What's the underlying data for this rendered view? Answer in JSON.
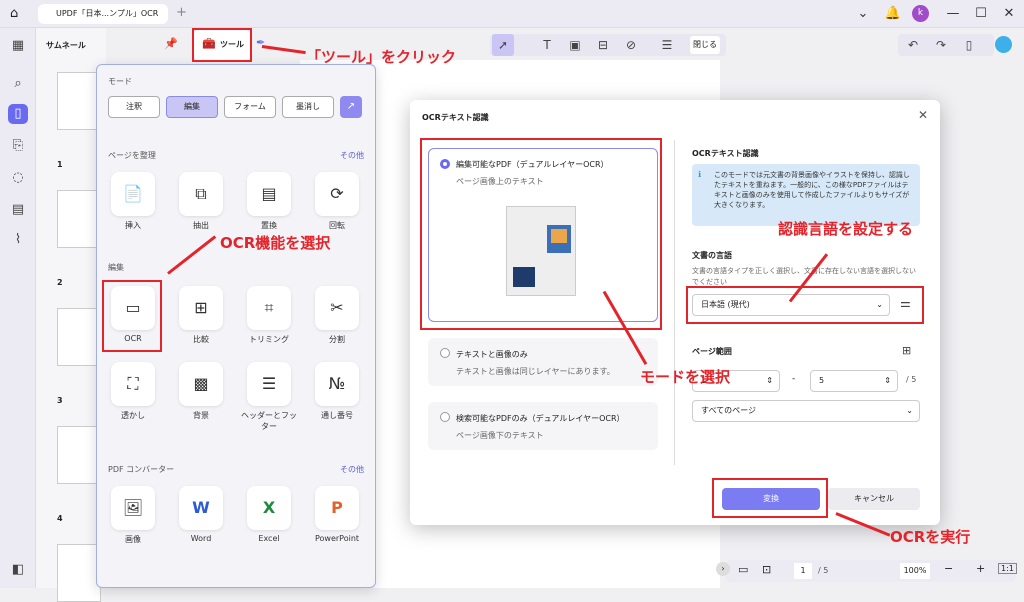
{
  "app": {
    "tab_title": "UPDF「日本...ンプル」OCR",
    "user_initial": "k"
  },
  "thumbs": {
    "title": "サムネール",
    "pages": [
      "1",
      "2",
      "3",
      "4"
    ]
  },
  "toolbar": {
    "tool_label": "ツール",
    "close_label": "閉じる"
  },
  "tool_panel": {
    "mode_title": "モード",
    "modes": [
      "注釈",
      "編集",
      "フォーム",
      "墨消し"
    ],
    "organize_title": "ページを整理",
    "organize_more": "その他",
    "organize": [
      "挿入",
      "抽出",
      "置換",
      "回転"
    ],
    "edit_title": "編集",
    "edit_tools": [
      "OCR",
      "比較",
      "トリミング",
      "分割",
      "透かし",
      "背景",
      "ヘッダーとフッター",
      "通し番号"
    ],
    "converter_title": "PDF コンバーター",
    "converter_more": "その他",
    "converters": [
      "画像",
      "Word",
      "Excel",
      "PowerPoint"
    ]
  },
  "ocr_dialog": {
    "title": "OCRテキスト認識",
    "options": [
      {
        "title": "編集可能なPDF（デュアルレイヤーOCR）",
        "desc": "ページ画像上のテキスト"
      },
      {
        "title": "テキストと画像のみ",
        "desc": "テキストと画像は同じレイヤーにあります。"
      },
      {
        "title": "検索可能なPDFのみ（デュアルレイヤーOCR）",
        "desc": "ページ画像下のテキスト"
      }
    ],
    "right_title": "OCRテキスト認識",
    "info": "このモードでは元文書の背景画像やイラストを保持し、認識したテキストを重ねます。一般的に、この様なPDFファイルはテキストと画像のみを使用して作成したファイルよりもサイズが大きくなります。",
    "lang_title": "文書の言語",
    "lang_desc": "文書の言語タイプを正しく選択し、文書に存在しない言語を選択しないでください",
    "lang_value": "日本語 (現代)",
    "range_title": "ページ範囲",
    "range_from": "1",
    "range_to": "5",
    "range_total": "/ 5",
    "range_select": "すべてのページ",
    "convert": "変換",
    "cancel": "キャンセル"
  },
  "annotations": {
    "click_tool": "「ツール」をクリック",
    "select_ocr": "OCR機能を選択",
    "set_lang": "認識言語を設定する",
    "select_mode": "モードを選択",
    "run_ocr": "OCRを実行"
  },
  "statusbar": {
    "page": "1",
    "total": "/ 5",
    "zoom": "100%"
  },
  "colors": {
    "accent": "#6a6af0",
    "annotation_red": "#e3242b"
  }
}
